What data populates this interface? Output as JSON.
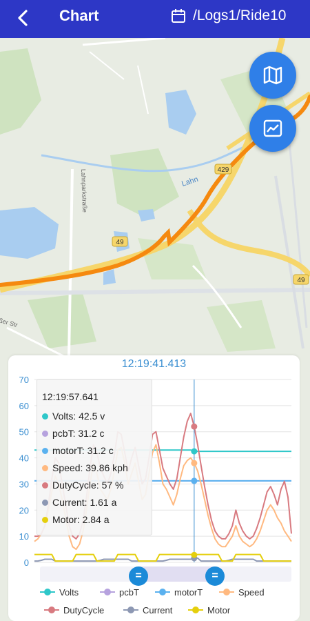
{
  "header": {
    "title": "Chart",
    "path": "/Logs1/Ride10"
  },
  "map": {
    "labels": {
      "road_a": "429",
      "road_b": "49",
      "road_c": "49",
      "river": "Lahn",
      "street": "Lahnparkstraße",
      "street_left": "ßer Str"
    }
  },
  "fabs": {
    "map_icon": "map-icon",
    "chart_icon": "chart-icon"
  },
  "chart": {
    "cursor_time": "12:19:41.413",
    "tooltip": {
      "time": "12:19:57.641",
      "rows": [
        {
          "name": "Volts",
          "text": "Volts: 42.5 v",
          "color": "#2ec7c9"
        },
        {
          "name": "pcbT",
          "text": "pcbT: 31.2 c",
          "color": "#b6a2de"
        },
        {
          "name": "motorT",
          "text": "motorT: 31.2 c",
          "color": "#5ab1ef"
        },
        {
          "name": "Speed",
          "text": "Speed: 39.86 kph",
          "color": "#ffb980"
        },
        {
          "name": "DutyCycle",
          "text": "DutyCycle: 57 %",
          "color": "#d87a80"
        },
        {
          "name": "Current",
          "text": "Current: 1.61 a",
          "color": "#8d98b3"
        },
        {
          "name": "Motor",
          "text": "Motor: 2.84 a",
          "color": "#e5cf0d"
        }
      ]
    },
    "legend": [
      {
        "name": "Volts",
        "color": "#2ec7c9"
      },
      {
        "name": "pcbT",
        "color": "#b6a2de"
      },
      {
        "name": "motorT",
        "color": "#5ab1ef"
      },
      {
        "name": "Speed",
        "color": "#ffb980"
      },
      {
        "name": "DutyCycle",
        "color": "#d87a80"
      },
      {
        "name": "Current",
        "color": "#8d98b3"
      },
      {
        "name": "Motor",
        "color": "#e5cf0d"
      }
    ],
    "handle_left": "=",
    "handle_right": "="
  },
  "chart_data": {
    "type": "line",
    "ylim": [
      0,
      70
    ],
    "yticks": [
      "0",
      "10",
      "20",
      "30",
      "40",
      "50",
      "60",
      "70"
    ],
    "x": [
      0,
      1,
      2,
      3,
      4,
      5,
      6,
      7,
      8,
      9,
      10,
      11,
      12,
      13,
      14,
      15,
      16,
      17,
      18,
      19,
      20,
      21,
      22,
      23,
      24,
      25,
      26,
      27,
      28,
      29,
      30,
      31,
      32,
      33,
      34,
      35,
      36,
      37,
      38,
      39,
      40,
      41,
      42,
      43,
      44,
      45,
      46,
      47,
      48,
      49,
      50,
      51,
      52,
      53,
      54,
      55,
      56,
      57,
      58,
      59,
      60,
      61,
      62,
      63,
      64,
      65,
      66,
      67,
      68,
      69,
      70,
      71,
      72,
      73,
      74
    ],
    "cursor_index": 46,
    "series": [
      {
        "name": "Volts",
        "color": "#2ec7c9",
        "values": [
          43,
          43,
          43,
          43,
          43,
          43,
          43,
          43,
          43,
          43,
          43,
          43,
          43,
          43,
          43,
          43,
          43,
          43,
          43,
          43,
          43,
          43,
          43,
          43,
          43,
          43,
          43,
          43,
          43,
          43,
          43,
          43,
          43,
          43,
          43,
          43,
          43,
          43,
          43,
          43,
          43,
          43,
          43,
          43,
          43,
          43,
          42.5,
          42.5,
          42.5,
          42.5,
          42.5,
          42.5,
          42.5,
          42.5,
          42.5,
          42.5,
          42.5,
          42.5,
          42.5,
          42.5,
          42.5,
          42.5,
          42.5,
          42.5,
          42.5,
          42.5,
          42.5,
          42.5,
          42.5,
          42.5,
          42.5,
          42.5,
          42.5,
          42.5,
          42.5
        ]
      },
      {
        "name": "pcbT",
        "color": "#b6a2de",
        "values": [
          31.2,
          31.2,
          31.2,
          31.2,
          31.2,
          31.2,
          31.2,
          31.2,
          31.2,
          31.2,
          31.2,
          31.2,
          31.2,
          31.2,
          31.2,
          31.2,
          31.2,
          31.2,
          31.2,
          31.2,
          31.2,
          31.2,
          31.2,
          31.2,
          31.2,
          31.2,
          31.2,
          31.2,
          31.2,
          31.2,
          31.2,
          31.2,
          31.2,
          31.2,
          31.2,
          31.2,
          31.2,
          31.2,
          31.2,
          31.2,
          31.2,
          31.2,
          31.2,
          31.2,
          31.2,
          31.2,
          31.2,
          31.2,
          31.2,
          31.2,
          31.2,
          31.2,
          31.2,
          31.2,
          31.2,
          31.2,
          31.2,
          31.2,
          31.2,
          31.2,
          31.2,
          31.2,
          31.2,
          31.2,
          31.2,
          31.2,
          31.2,
          31.2,
          31.2,
          31.2,
          31.2,
          31.2,
          31.2,
          31.2,
          31.2
        ]
      },
      {
        "name": "motorT",
        "color": "#5ab1ef",
        "values": [
          31.2,
          31.2,
          31.2,
          31.2,
          31.2,
          31.2,
          31.2,
          31.2,
          31.2,
          31.2,
          31.2,
          31.2,
          31.2,
          31.2,
          31.2,
          31.2,
          31.2,
          31.2,
          31.2,
          31.2,
          31.2,
          31.2,
          31.2,
          31.2,
          31.2,
          31.2,
          31.2,
          31.2,
          31.2,
          31.2,
          31.2,
          31.2,
          31.2,
          31.2,
          31.2,
          31.2,
          31.2,
          31.2,
          31.2,
          31.2,
          31.2,
          31.2,
          31.2,
          31.2,
          31.2,
          31.2,
          31.2,
          31.2,
          31.2,
          31.2,
          31.2,
          31.2,
          31.2,
          31.2,
          31.2,
          31.2,
          31.2,
          31.2,
          31.2,
          31.2,
          31.2,
          31.2,
          31.2,
          31.2,
          31.2,
          31.2,
          31.2,
          31.2,
          31.2,
          31.2,
          31.2,
          31.2,
          31.2,
          31.2,
          31.2
        ]
      },
      {
        "name": "Speed",
        "color": "#ffb980",
        "values": [
          8,
          9,
          11,
          14,
          20,
          27,
          33,
          30,
          24,
          17,
          10,
          6,
          5,
          7,
          12,
          20,
          30,
          38,
          34,
          28,
          26,
          24,
          28,
          35,
          43,
          44,
          38,
          30,
          34,
          38,
          31,
          24,
          26,
          34,
          42,
          45,
          38,
          30,
          28,
          25,
          22,
          26,
          32,
          37,
          39,
          40,
          38,
          35,
          30,
          24,
          18,
          13,
          9,
          7,
          6,
          6,
          8,
          10,
          14,
          10,
          8,
          7,
          6,
          7,
          9,
          12,
          16,
          20,
          22,
          20,
          17,
          15,
          12,
          10,
          8
        ]
      },
      {
        "name": "DutyCycle",
        "color": "#d87a80",
        "values": [
          10,
          10,
          11,
          14,
          22,
          32,
          40,
          38,
          30,
          22,
          14,
          10,
          9,
          11,
          16,
          25,
          36,
          45,
          42,
          36,
          33,
          30,
          34,
          41,
          50,
          49,
          42,
          35,
          40,
          44,
          37,
          30,
          32,
          40,
          49,
          50,
          43,
          36,
          33,
          30,
          28,
          32,
          40,
          48,
          54,
          57,
          52,
          45,
          37,
          29,
          22,
          16,
          12,
          10,
          9,
          9,
          11,
          14,
          20,
          15,
          12,
          10,
          9,
          10,
          13,
          17,
          22,
          27,
          29,
          26,
          22,
          28,
          31,
          25,
          11
        ]
      },
      {
        "name": "Current",
        "color": "#8d98b3",
        "values": [
          0.5,
          0.5,
          0.8,
          1.2,
          1.2,
          1.2,
          0.5,
          0.5,
          0.5,
          0.5,
          0.5,
          0.5,
          0.5,
          0.5,
          0.5,
          0.5,
          0.5,
          0.5,
          0.5,
          0.8,
          1.2,
          1.2,
          1.2,
          1.2,
          1.2,
          1.2,
          1.2,
          1.2,
          0.5,
          0.5,
          0.5,
          0.5,
          0.5,
          0.5,
          0.5,
          0.5,
          0.5,
          0.5,
          0.8,
          1.2,
          1.2,
          1.2,
          1.2,
          1.2,
          1.2,
          1.2,
          1.6,
          1.6,
          0.5,
          0.5,
          0.5,
          0.5,
          0.5,
          0.5,
          0.5,
          0.5,
          0.8,
          1.2,
          1.2,
          1.2,
          1.2,
          1.2,
          1.2,
          1.2,
          0.5,
          0.5,
          0.5,
          0.5,
          0.5,
          0.5,
          0.5,
          0.5,
          0.5,
          0.5,
          0.5
        ]
      },
      {
        "name": "Motor",
        "color": "#e5cf0d",
        "values": [
          3,
          3,
          3,
          3,
          3,
          3,
          0.5,
          0.5,
          0.5,
          0.5,
          0.5,
          0.5,
          3,
          3,
          3,
          3,
          3,
          3,
          0.5,
          0.5,
          0.5,
          0.5,
          0.5,
          0.5,
          3,
          3,
          3,
          3,
          3,
          3,
          0.5,
          0.5,
          0.5,
          0.5,
          0.5,
          0.5,
          3,
          3,
          3,
          3,
          3,
          3,
          3,
          3,
          3,
          3,
          2.84,
          3,
          3,
          3,
          3,
          3,
          3,
          3,
          0.5,
          0.5,
          0.5,
          0.5,
          3,
          3,
          3,
          3,
          3,
          3,
          3,
          3,
          0.5,
          0.5,
          0.5,
          0.5,
          0.5,
          0.5,
          0.5,
          0.5,
          0.5
        ]
      }
    ]
  }
}
